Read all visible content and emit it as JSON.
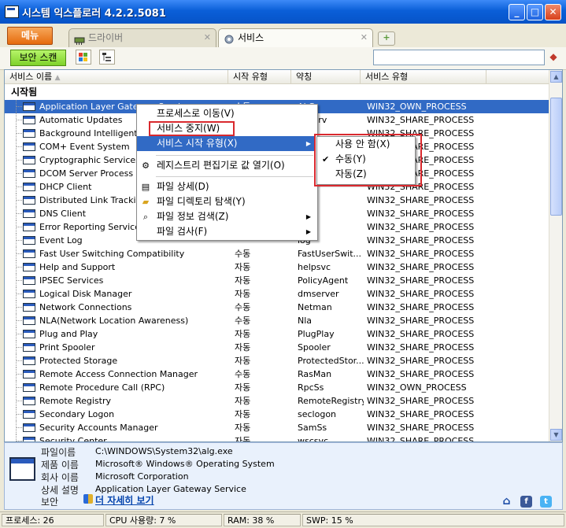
{
  "window": {
    "title": "시스템 익스플로러 4.2.2.5081",
    "minimize": "_",
    "maximize": "□",
    "close": "✕"
  },
  "menu": {
    "label": "메뉴"
  },
  "tabs": [
    {
      "label": "드라이버",
      "active": false,
      "close": "✕"
    },
    {
      "label": "서비스",
      "active": true,
      "close": "✕"
    }
  ],
  "new_tab": "+",
  "toolbar": {
    "scan_label": "보안 스캔",
    "search_value": ""
  },
  "columns": [
    "서비스 이름",
    "시작 유형",
    "약칭",
    "서비스 유형"
  ],
  "sort_indicator": "▲",
  "group_label": "시작됨",
  "rows": [
    {
      "name": "Application Layer Gateway Service",
      "start": "수동",
      "short": "ALG",
      "type": "WIN32_OWN_PROCESS",
      "selected": true
    },
    {
      "name": "Automatic Updates",
      "start": "",
      "short": "auserv",
      "type": "WIN32_SHARE_PROCESS"
    },
    {
      "name": "Background Intelligent Tra",
      "start": "",
      "short": "",
      "type": "WIN32_SHARE_PROCESS"
    },
    {
      "name": "COM+ Event System",
      "start": "",
      "short": "",
      "type": "WIN32_SHARE_PROCESS"
    },
    {
      "name": "Cryptographic Services",
      "start": "",
      "short": "",
      "type": "WIN32_SHARE_PROCESS"
    },
    {
      "name": "DCOM Server Process La",
      "start": "",
      "short": "",
      "type": "WIN32_SHARE_PROCESS"
    },
    {
      "name": "DHCP Client",
      "start": "",
      "short": "",
      "type": "WIN32_SHARE_PROCESS"
    },
    {
      "name": "Distributed Link Tracking",
      "start": "",
      "short": "ks",
      "type": "WIN32_SHARE_PROCESS"
    },
    {
      "name": "DNS Client",
      "start": "",
      "short": "ache",
      "type": "WIN32_SHARE_PROCESS"
    },
    {
      "name": "Error Reporting Service",
      "start": "",
      "short": "c",
      "type": "WIN32_SHARE_PROCESS"
    },
    {
      "name": "Event Log",
      "start": "",
      "short": "log",
      "type": "WIN32_SHARE_PROCESS"
    },
    {
      "name": "Fast User Switching Compatibility",
      "start": "수동",
      "short": "FastUserSwit...",
      "type": "WIN32_SHARE_PROCESS"
    },
    {
      "name": "Help and Support",
      "start": "자동",
      "short": "helpsvc",
      "type": "WIN32_SHARE_PROCESS"
    },
    {
      "name": "IPSEC Services",
      "start": "자동",
      "short": "PolicyAgent",
      "type": "WIN32_SHARE_PROCESS"
    },
    {
      "name": "Logical Disk Manager",
      "start": "자동",
      "short": "dmserver",
      "type": "WIN32_SHARE_PROCESS"
    },
    {
      "name": "Network Connections",
      "start": "수동",
      "short": "Netman",
      "type": "WIN32_SHARE_PROCESS"
    },
    {
      "name": "NLA(Network Location Awareness)",
      "start": "수동",
      "short": "Nla",
      "type": "WIN32_SHARE_PROCESS"
    },
    {
      "name": "Plug and Play",
      "start": "자동",
      "short": "PlugPlay",
      "type": "WIN32_SHARE_PROCESS"
    },
    {
      "name": "Print Spooler",
      "start": "자동",
      "short": "Spooler",
      "type": "WIN32_SHARE_PROCESS"
    },
    {
      "name": "Protected Storage",
      "start": "자동",
      "short": "ProtectedStor...",
      "type": "WIN32_SHARE_PROCESS"
    },
    {
      "name": "Remote Access Connection Manager",
      "start": "수동",
      "short": "RasMan",
      "type": "WIN32_SHARE_PROCESS"
    },
    {
      "name": "Remote Procedure Call (RPC)",
      "start": "자동",
      "short": "RpcSs",
      "type": "WIN32_OWN_PROCESS"
    },
    {
      "name": "Remote Registry",
      "start": "자동",
      "short": "RemoteRegistry",
      "type": "WIN32_SHARE_PROCESS"
    },
    {
      "name": "Secondary Logon",
      "start": "자동",
      "short": "seclogon",
      "type": "WIN32_SHARE_PROCESS"
    },
    {
      "name": "Security Accounts Manager",
      "start": "자동",
      "short": "SamSs",
      "type": "WIN32_SHARE_PROCESS"
    },
    {
      "name": "Security Center",
      "start": "자동",
      "short": "wscsvc",
      "type": "WIN32_SHARE_PROCESS"
    }
  ],
  "context_menu": [
    {
      "label": "프로세스로 이동(V)"
    },
    {
      "label": "서비스 중지(W)"
    },
    {
      "label": "서비스 시작 유형(X)",
      "highlighted": true,
      "submenu": true
    },
    {
      "label": "레지스트리 편집기로 값 열기(O)",
      "icon": "registry-icon"
    },
    {
      "label": "파일 상세(D)",
      "icon": "file-details-icon"
    },
    {
      "label": "파일 디렉토리 탐색(Y)",
      "icon": "folder-icon"
    },
    {
      "label": "파일 정보 검색(Z)",
      "icon": "search-icon",
      "submenu": true
    },
    {
      "label": "파일 검사(F)",
      "submenu": true
    }
  ],
  "submenu": [
    {
      "label": "사용 안 함(X)",
      "checked": false
    },
    {
      "label": "수동(Y)",
      "checked": true
    },
    {
      "label": "자동(Z)",
      "checked": false
    }
  ],
  "details": {
    "file_name_label": "파일이름",
    "file_name": "C:\\WINDOWS\\System32\\alg.exe",
    "product_label": "제품 이름",
    "product": "Microsoft® Windows® Operating System",
    "company_label": "회사 이름",
    "company": "Microsoft Corporation",
    "desc_label": "상세 설명",
    "desc": "Application Layer Gateway Service",
    "security_label": "보안",
    "more_link": "더 자세히 보기"
  },
  "status": {
    "processes": "프로세스: 26",
    "cpu": "CPU 사용량: 7 %",
    "ram": "RAM: 38 %",
    "swp": "SWP: 15 %"
  },
  "colors": {
    "selection": "#316ac5",
    "title_bar": "#0a5fd8",
    "highlight_box": "#d9292e"
  }
}
